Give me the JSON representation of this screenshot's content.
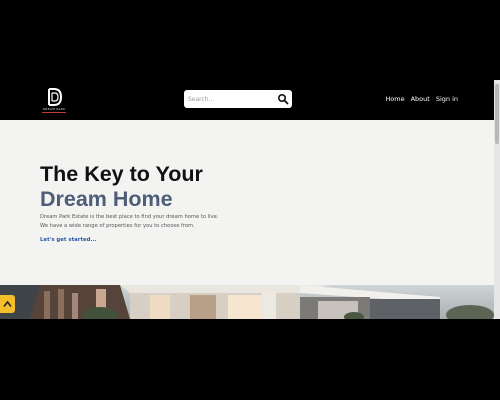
{
  "brand": {
    "logo_text": "DREAM PARK"
  },
  "search": {
    "placeholder": "Search..."
  },
  "nav": {
    "items": [
      "Home",
      "About",
      "Sign in"
    ]
  },
  "hero": {
    "title_line1": "The Key to Your",
    "title_line2": "Dream Home",
    "description_line1": "Dream Park Estate is the best place to find your dream home to live.",
    "description_line2": "We have a wide range of properties for you to choose from.",
    "cta": "Let's get started..."
  },
  "colors": {
    "accent_title": "#4f5e78",
    "link": "#2d56a8",
    "scroll_button": "#f3bd2c",
    "navbar": "#000000",
    "hero_bg": "#f3f4f2"
  },
  "icons": {
    "search": "search-icon",
    "scroll_top": "chevron-up-icon",
    "logo": "dp-monogram-icon"
  }
}
